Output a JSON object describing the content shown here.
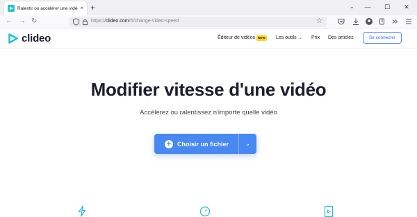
{
  "browser": {
    "tab_title": "Ralentir ou accélérer une vidéo",
    "tab_close": "×",
    "new_tab": "+",
    "tabs_list": "⌄",
    "win_min": "—",
    "win_max": "☐",
    "win_close": "✕",
    "nav_back": "←",
    "nav_forward": "→",
    "nav_reload": "↻",
    "url_prefix": "https://",
    "url_domain": "clideo.com",
    "url_path": "/fr/change-video-speed",
    "bookmark": "☆",
    "icons": [
      "back-arrow-icon",
      "forward-arrow-icon",
      "reload-icon",
      "shield-icon",
      "lock-icon",
      "star-icon",
      "pocket-icon",
      "download-icon",
      "account-icon",
      "extension-icon",
      "overflow-icon",
      "hamburger-menu-icon"
    ]
  },
  "site": {
    "logo_text": "clideo",
    "nav": {
      "editor": "Éditeur de vidéos",
      "editor_badge": "NEW",
      "tools": "Les outils",
      "tools_chevron": "⌄",
      "pricing": "Prix",
      "articles": "Des articles",
      "login": "Se connecter"
    }
  },
  "hero": {
    "title": "Modifier vitesse d'une vidéo",
    "subtitle": "Accélérez ou ralentissez n'importe quelle vidéo",
    "cta_plus": "+",
    "cta_label": "Choisir un fichier",
    "cta_dropdown": "⌄"
  },
  "features": [
    "lightning-icon",
    "speedometer-icon",
    "video-file-icon"
  ],
  "colors": {
    "brand_blue": "#4788f3",
    "logo_teal": "#21c1d6",
    "badge_yellow": "#ffd21f",
    "title_dark": "#1c1d2e",
    "feature_icon": "#2ab6d0"
  }
}
